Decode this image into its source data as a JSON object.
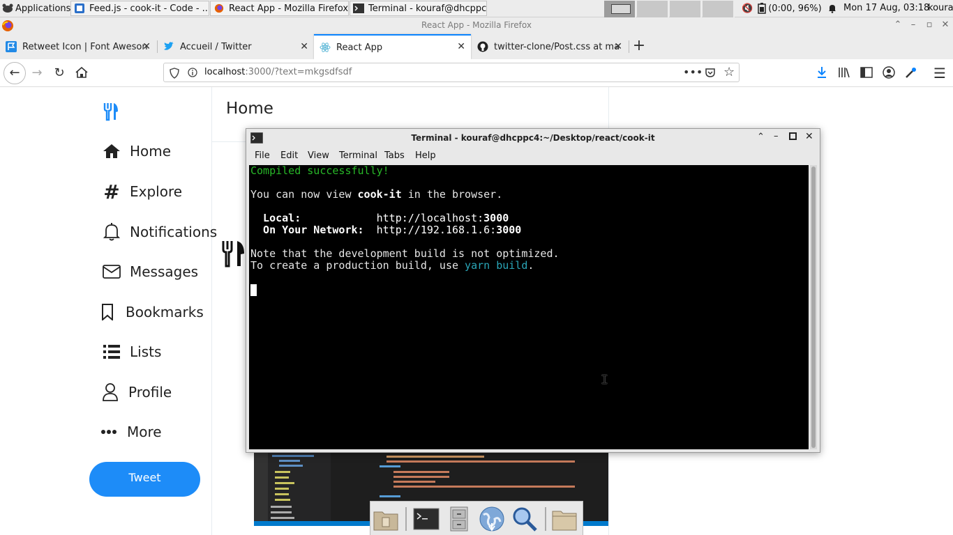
{
  "panel": {
    "apps_label": "Applications",
    "tasks": [
      {
        "label": "Feed.js - cook-it - Code - ...",
        "icon": "vscode-icon"
      },
      {
        "label": "React App - Mozilla Firefox",
        "icon": "firefox-icon"
      },
      {
        "label": "Terminal - kouraf@dhcppc...",
        "icon": "terminal-icon"
      }
    ],
    "battery": "(0:00, 96%)",
    "clock": "Mon 17 Aug, 03:18",
    "user": "kouraf"
  },
  "firefox": {
    "window_title": "React App - Mozilla Firefox",
    "tabs": [
      {
        "label": "Retweet Icon | Font Aweson",
        "icon": "fontawesome-icon"
      },
      {
        "label": "Accueil / Twitter",
        "icon": "twitter-icon"
      },
      {
        "label": "React App",
        "icon": "react-icon"
      },
      {
        "label": "twitter-clone/Post.css at ma",
        "icon": "github-icon"
      }
    ],
    "url_host": "localhost",
    "url_rest": ":3000/?text=mkgsdfsdf"
  },
  "app": {
    "page_title": "Home",
    "sidebar": [
      {
        "label": "Home",
        "icon": "home-icon"
      },
      {
        "label": "Explore",
        "icon": "hashtag-icon"
      },
      {
        "label": "Notifications",
        "icon": "bell-icon"
      },
      {
        "label": "Messages",
        "icon": "envelope-icon"
      },
      {
        "label": "Bookmarks",
        "icon": "bookmark-icon"
      },
      {
        "label": "Lists",
        "icon": "list-icon"
      },
      {
        "label": "Profile",
        "icon": "user-icon"
      },
      {
        "label": "More",
        "icon": "ellipsis-icon"
      }
    ],
    "tweet_button": "Tweet"
  },
  "terminal": {
    "title": "Terminal - kouraf@dhcppc4:~/Desktop/react/cook-it",
    "menu": [
      "File",
      "Edit",
      "View",
      "Terminal",
      "Tabs",
      "Help"
    ],
    "line_compiled": "Compiled successfully!",
    "line_view_pre": "You can now view ",
    "line_view_app": "cook-it",
    "line_view_post": " in the browser.",
    "local_label": "  Local:",
    "local_url_pre": "            http://localhost:",
    "local_port": "3000",
    "network_label": "  On Your Network:",
    "network_url_pre": "  http://192.168.1.6:",
    "network_port": "3000",
    "note1": "Note that the development build is not optimized.",
    "note2_pre": "To create a production build, use ",
    "note2_cmd": "yarn build",
    "note2_post": "."
  },
  "colors": {
    "terminal_green": "#28b828",
    "terminal_cyan": "#2aa6b8",
    "tweet_blue": "#1d8cf8",
    "firefox_accent": "#0a84ff"
  }
}
